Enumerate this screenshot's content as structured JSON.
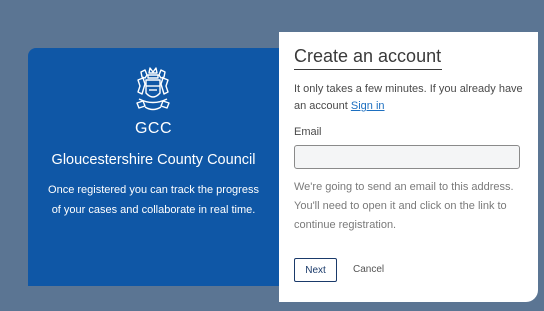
{
  "left_panel": {
    "logo_text": "GCC",
    "council_name": "Gloucestershire County Council",
    "blurb": "Once registered you can track the progress of your cases and collaborate in real time.",
    "background_color": "#0f57a6",
    "crest_icon": "coat-of-arms-icon"
  },
  "form": {
    "title": "Create an account",
    "intro_text": "It only takes a few minutes. If you already have an account ",
    "sign_in_link": "Sign in",
    "email_label": "Email",
    "email_value": "",
    "email_note": "We're going to send an email to this address. You'll need to open it and click on the link to continue registration.",
    "next_label": "Next",
    "cancel_label": "Cancel"
  }
}
